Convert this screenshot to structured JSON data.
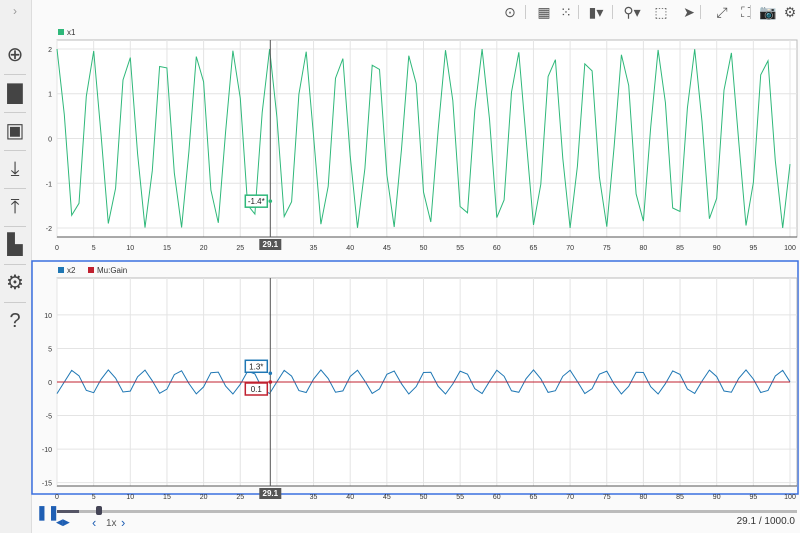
{
  "sidebar": {
    "items": [
      {
        "icon": "add-icon",
        "glyph": "⊕"
      },
      {
        "icon": "folder-icon",
        "glyph": "▇"
      },
      {
        "icon": "save-icon",
        "glyph": "▣"
      },
      {
        "icon": "download-icon",
        "glyph": "⤓"
      },
      {
        "icon": "upload-icon",
        "glyph": "⤒"
      },
      {
        "icon": "document-icon",
        "glyph": "▙"
      },
      {
        "icon": "gear-icon",
        "glyph": "⚙"
      },
      {
        "icon": "help-icon",
        "glyph": "?"
      }
    ],
    "expand_glyph": "›"
  },
  "toolbar": [
    {
      "icon": "replay-icon",
      "glyph": "⊙"
    },
    {
      "icon": "layout-icon",
      "glyph": "▦"
    },
    {
      "icon": "grid-icon",
      "glyph": "⁙"
    },
    {
      "icon": "visualization-icon",
      "glyph": "▮▾"
    },
    {
      "icon": "zoom-icon",
      "glyph": "⚲▾"
    },
    {
      "icon": "fit-to-view-icon",
      "glyph": "⬚"
    },
    {
      "icon": "cursor-icon",
      "glyph": "➤"
    },
    {
      "icon": "expand-icon",
      "glyph": "⤢"
    },
    {
      "icon": "fullscreen-icon",
      "glyph": "⛶"
    },
    {
      "icon": "camera-icon",
      "glyph": "📷"
    },
    {
      "icon": "settings-icon",
      "glyph": "⚙"
    }
  ],
  "colors": {
    "x1": "#2fb87a",
    "x2": "#1f77b4",
    "mu_gain": "#c0202f",
    "active_border": "#3b6fe0"
  },
  "plots": [
    {
      "legend": [
        {
          "name": "x1",
          "color": "#2fb87a"
        }
      ],
      "ylim": [
        -2.2,
        2.2
      ],
      "yticks": [
        "-2",
        "-1",
        "0",
        "1",
        "2"
      ],
      "ytick_values": [
        -2,
        -1,
        0,
        1,
        2
      ],
      "cursor_value": "-1.4*",
      "cursor_label": "29.1"
    },
    {
      "legend": [
        {
          "name": "x2",
          "color": "#1f77b4"
        },
        {
          "name": "Mu:Gain",
          "color": "#c0202f"
        }
      ],
      "ylim": [
        -15.5,
        15.5
      ],
      "yticks": [
        "-15",
        "-10",
        "-5",
        "0",
        "5",
        "10"
      ],
      "ytick_values": [
        -15,
        -10,
        -5,
        0,
        5,
        10
      ],
      "cursor_values": [
        "1.3*",
        "0.1"
      ],
      "cursor_label": "29.1"
    }
  ],
  "xticks": [
    "0",
    "5",
    "10",
    "15",
    "20",
    "25",
    "30",
    "35",
    "40",
    "45",
    "50",
    "55",
    "60",
    "65",
    "70",
    "75",
    "80",
    "85",
    "90",
    "95",
    "100"
  ],
  "chart_data": [
    {
      "type": "line",
      "xlim": [
        0,
        100
      ],
      "ylim": [
        -2.2,
        2.2
      ],
      "grid": true,
      "series": [
        {
          "name": "x1",
          "model": "2*cos(2*pi*t/4.83)",
          "t_step": 1
        }
      ]
    },
    {
      "type": "line",
      "xlim": [
        0,
        100
      ],
      "ylim": [
        -15.5,
        15.5
      ],
      "grid": true,
      "series": [
        {
          "name": "x2",
          "model": "1.8*sin(2*pi*(t-1)/4.83)",
          "t_step": 1
        },
        {
          "name": "Mu:Gain",
          "constant": 0
        }
      ]
    }
  ],
  "cursor_time": 29.1,
  "playback": {
    "pause_glyph": "❚❚",
    "step_glyph": "◀▶",
    "prev": "‹",
    "speed": "1x",
    "next": "›",
    "time": "29.1 / 1000.0",
    "progress": 0.0291
  }
}
